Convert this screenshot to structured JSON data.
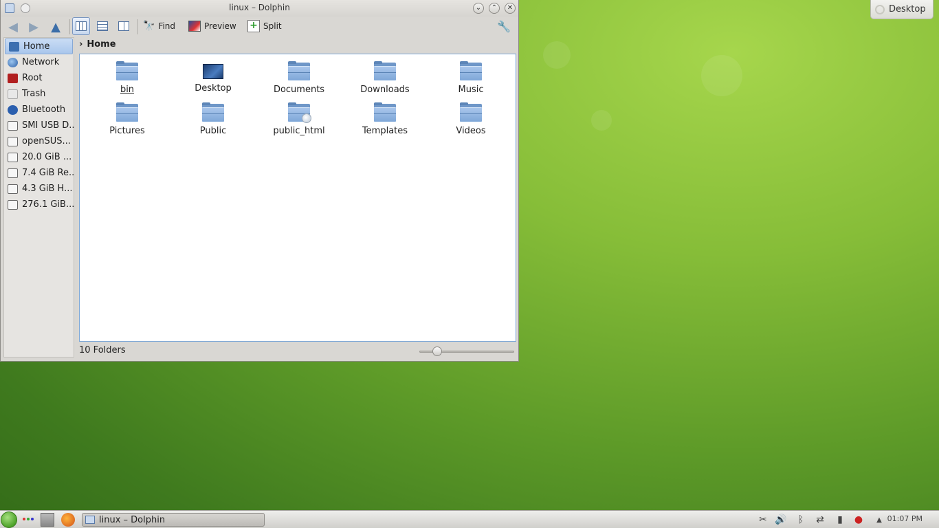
{
  "desktop": {
    "corner_button_label": "Desktop"
  },
  "window": {
    "title": "linux – Dolphin",
    "buttons": {
      "minimize": "⌄",
      "maximize": "⌃",
      "close": "✕"
    }
  },
  "toolbar": {
    "find_label": "Find",
    "preview_label": "Preview",
    "split_label": "Split"
  },
  "sidebar": {
    "items": [
      {
        "label": "Home",
        "icon": "home-folder-icon"
      },
      {
        "label": "Network",
        "icon": "network-globe-icon"
      },
      {
        "label": "Root",
        "icon": "root-folder-icon"
      },
      {
        "label": "Trash",
        "icon": "trash-icon"
      },
      {
        "label": "Bluetooth",
        "icon": "bluetooth-icon"
      },
      {
        "label": "SMI USB D...",
        "icon": "usb-drive-icon"
      },
      {
        "label": "openSUS...",
        "icon": "drive-icon"
      },
      {
        "label": "20.0 GiB ...",
        "icon": "drive-icon"
      },
      {
        "label": "7.4 GiB Re...",
        "icon": "drive-icon"
      },
      {
        "label": "4.3 GiB H...",
        "icon": "drive-icon"
      },
      {
        "label": "276.1 GiB...",
        "icon": "drive-icon"
      }
    ]
  },
  "breadcrumb": {
    "current": "Home"
  },
  "files": [
    {
      "name": "bin",
      "type": "folder"
    },
    {
      "name": "Desktop",
      "type": "desktop"
    },
    {
      "name": "Documents",
      "type": "folder"
    },
    {
      "name": "Downloads",
      "type": "folder"
    },
    {
      "name": "Music",
      "type": "folder"
    },
    {
      "name": "Pictures",
      "type": "folder"
    },
    {
      "name": "Public",
      "type": "folder"
    },
    {
      "name": "public_html",
      "type": "folder-web"
    },
    {
      "name": "Templates",
      "type": "folder"
    },
    {
      "name": "Videos",
      "type": "folder"
    }
  ],
  "statusbar": {
    "summary": "10 Folders",
    "zoom_level_fraction": 0.15
  },
  "taskbar": {
    "task_label": "linux – Dolphin",
    "clock": "01:07 PM"
  },
  "colors": {
    "selection": "#a9c6ec",
    "folder": "#7ea7d8",
    "desktop_green": "#6ea62e"
  }
}
